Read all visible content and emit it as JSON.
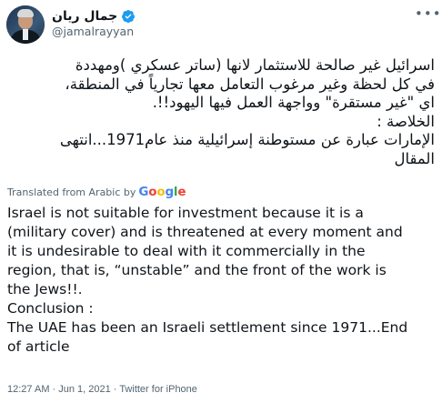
{
  "author": {
    "name": "جمال ريان",
    "handle": "@jamalrayyan",
    "verified_color": "#1d9bf0"
  },
  "menu_icon": "more-horizontal-icon",
  "tweet": {
    "arabic_lines": [
      "اسرائيل غير صالحة للاستثمار لانها (ساتر عسكري )ومهددة",
      "في كل لحظة  وغير مرغوب التعامل معها تجارياً في المنطقة،",
      "اي \"غير مستقرة\" وواجهة العمل فيها اليهود!!.",
      "الخلاصة :",
      "الإمارات عبارة عن مستوطنة إسرائيلية منذ عام1971...انتهى",
      "المقال"
    ],
    "translated_label": "Translated from Arabic by",
    "translator_brand": [
      "G",
      "o",
      "o",
      "g",
      "l",
      "e"
    ],
    "english_lines": [
      "Israel is not suitable for investment because it is a",
      "(military cover) and is threatened at every moment and",
      "it is undesirable to deal with it commercially in the",
      "region, that is, “unstable” and the front of the work is",
      "the Jews!!.",
      " Conclusion :",
      " The UAE has been an Israeli settlement since 1971...End",
      "of article"
    ],
    "meta": "12:27 AM · Jun 1, 2021 · Twitter for iPhone"
  }
}
